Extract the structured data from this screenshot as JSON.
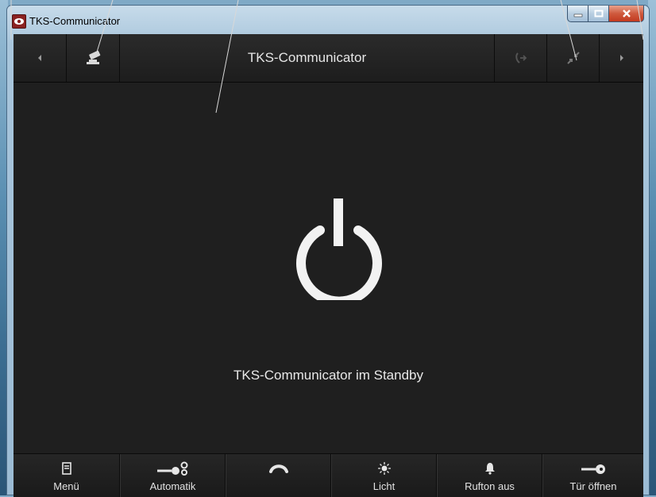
{
  "window": {
    "title": "TKS-Communicator"
  },
  "topbar": {
    "title": "TKS-Communicator",
    "icons": [
      "arrow-left-icon",
      "camera-icon",
      "call-forward-icon",
      "collapse-icon",
      "arrow-right-icon"
    ]
  },
  "main": {
    "status_text": "TKS-Communicator im Standby"
  },
  "bottombar": {
    "buttons": [
      {
        "label": "Menü",
        "icon": "menu-icon"
      },
      {
        "label": "Automatik",
        "icon": "key-gear-icon"
      },
      {
        "label": "",
        "icon": "hangup-icon"
      },
      {
        "label": "Licht",
        "icon": "light-icon"
      },
      {
        "label": "Rufton aus",
        "icon": "bell-icon"
      },
      {
        "label": "Tür öffnen",
        "icon": "key-icon"
      }
    ]
  },
  "colors": {
    "background": "#1f1f1f",
    "text": "#e6e6e6",
    "close": "#c23a1f"
  }
}
